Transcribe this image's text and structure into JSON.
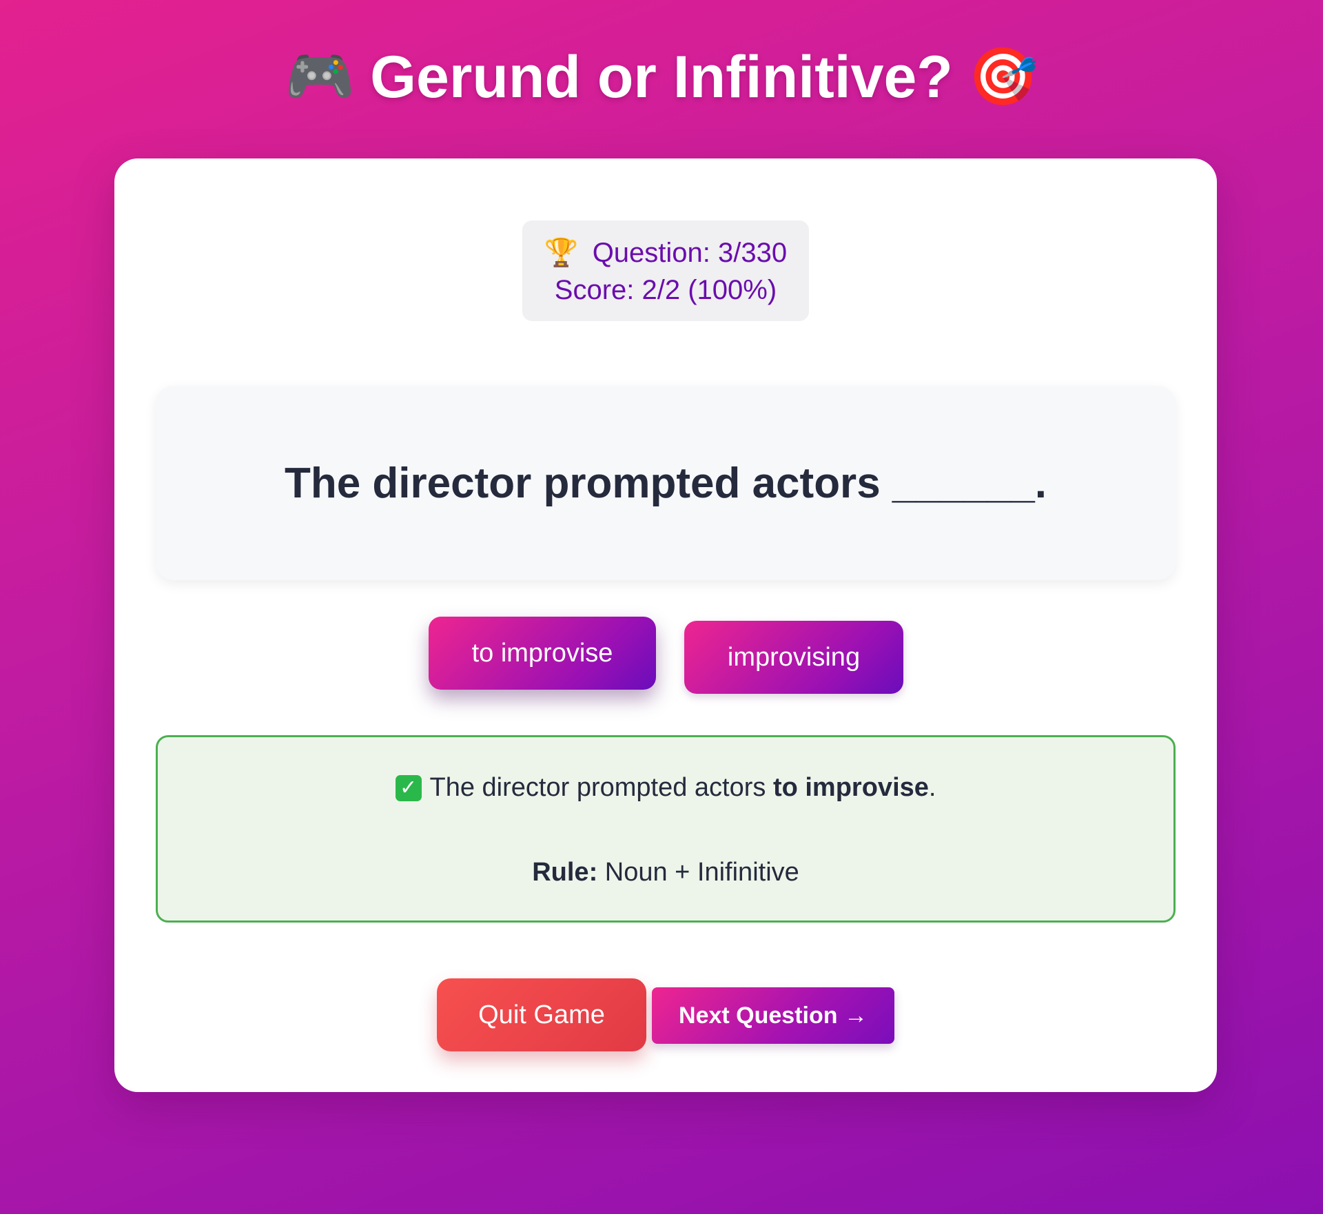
{
  "header": {
    "title": "Gerund or Infinitive?",
    "left_emoji": "🎮",
    "right_emoji": "🎯",
    "icons": [
      "gamepad-icon",
      "target-icon"
    ]
  },
  "stats": {
    "trophy": "🏆",
    "question_label": "Question: 3/330",
    "score_label": "Score: 2/2 (100%)"
  },
  "question": {
    "text": "The director prompted actors ______."
  },
  "options": [
    {
      "label": "to improvise"
    },
    {
      "label": "improvising"
    }
  ],
  "feedback": {
    "check": "✓",
    "sentence_prefix": "The director prompted actors ",
    "answer": "to improvise",
    "sentence_suffix": ".",
    "rule_label": "Rule:",
    "rule_text": " Noun + Inifinitive"
  },
  "actions": {
    "quit_label": "Quit Game",
    "next_label": "Next Question →"
  },
  "colors": {
    "gradient_start": "#e3218f",
    "gradient_end": "#8c10b0",
    "accent_purple": "#6a0dad",
    "success_green": "#4caf50",
    "quit_red": "#f7504f"
  }
}
